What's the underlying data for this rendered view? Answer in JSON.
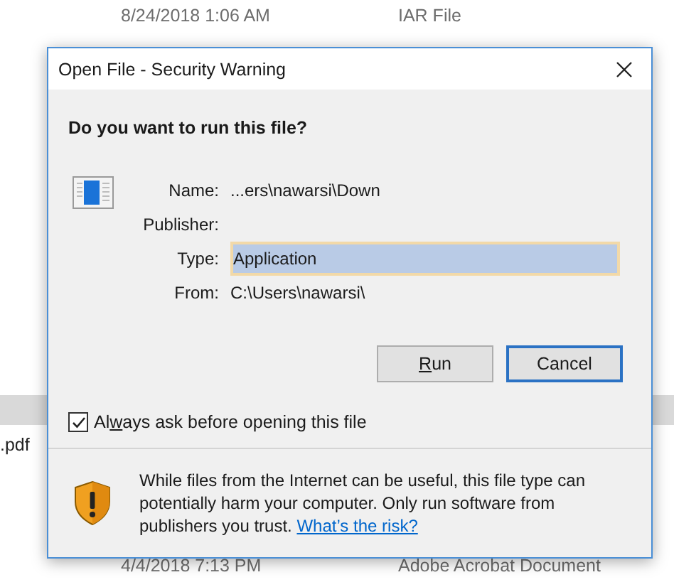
{
  "background_rows": [
    {
      "date": "8/24/2018 1:06 AM",
      "type": "IAR File",
      "selected": false
    },
    {
      "selected": true
    },
    {
      "name": ".pdf",
      "selected": false
    },
    {
      "date": "4/4/2018 7:13 PM",
      "type": "Adobe Acrobat Document",
      "selected": false
    }
  ],
  "dialog": {
    "title": "Open File - Security Warning",
    "heading": "Do you want to run this file?",
    "fields": [
      {
        "label": "Name:",
        "value": "...ers\\nawarsi\\Down",
        "kind": "text"
      },
      {
        "label": "Publisher:"
      },
      {
        "label": "Type:",
        "value": "Application",
        "kind": "selection"
      },
      {
        "label": "From:",
        "value": "C:\\Users\\nawarsi\\",
        "kind": "text"
      }
    ],
    "buttons": [
      {
        "label": {
          "key": "R",
          "after": "un"
        },
        "default": false
      },
      {
        "label": {
          "before": "Cancel"
        },
        "default": true
      }
    ],
    "checkbox": {
      "label": {
        "before": "Al",
        "key": "w",
        "after": "ays ask before opening this file"
      },
      "checked": true
    },
    "warning": {
      "text": "While files from the Internet can be useful, this file type can potentially harm your computer. Only run software from publishers you trust.",
      "link": "What’s the risk?"
    }
  }
}
